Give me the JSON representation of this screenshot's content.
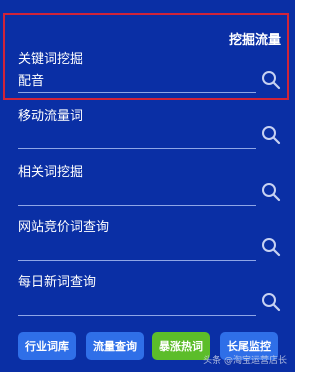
{
  "panel": {
    "title": "挖掘流量"
  },
  "fields": [
    {
      "label": "关键词挖掘",
      "value": "配音",
      "icon": "search-icon"
    },
    {
      "label": "移动流量词",
      "value": "",
      "icon": "search-icon"
    },
    {
      "label": "相关词挖掘",
      "value": "",
      "icon": "search-icon"
    },
    {
      "label": "网站竞价词查询",
      "value": "",
      "icon": "search-icon"
    },
    {
      "label": "每日新词查询",
      "value": "",
      "icon": "search-icon"
    }
  ],
  "buttons": [
    {
      "label": "行业词库",
      "color": "#2f6fe8"
    },
    {
      "label": "流量查询",
      "color": "#2f6fe8"
    },
    {
      "label": "暴涨热词",
      "color": "#5cbd2a"
    },
    {
      "label": "长尾监控",
      "color": "#2f6fe8"
    }
  ],
  "watermark": "头条 @淘宝运营店长",
  "colors": {
    "panel_bg": "#0a2fa5",
    "highlight_border": "#d0243a",
    "divider": "#8fa6e6",
    "icon": "#c7d1f2"
  }
}
